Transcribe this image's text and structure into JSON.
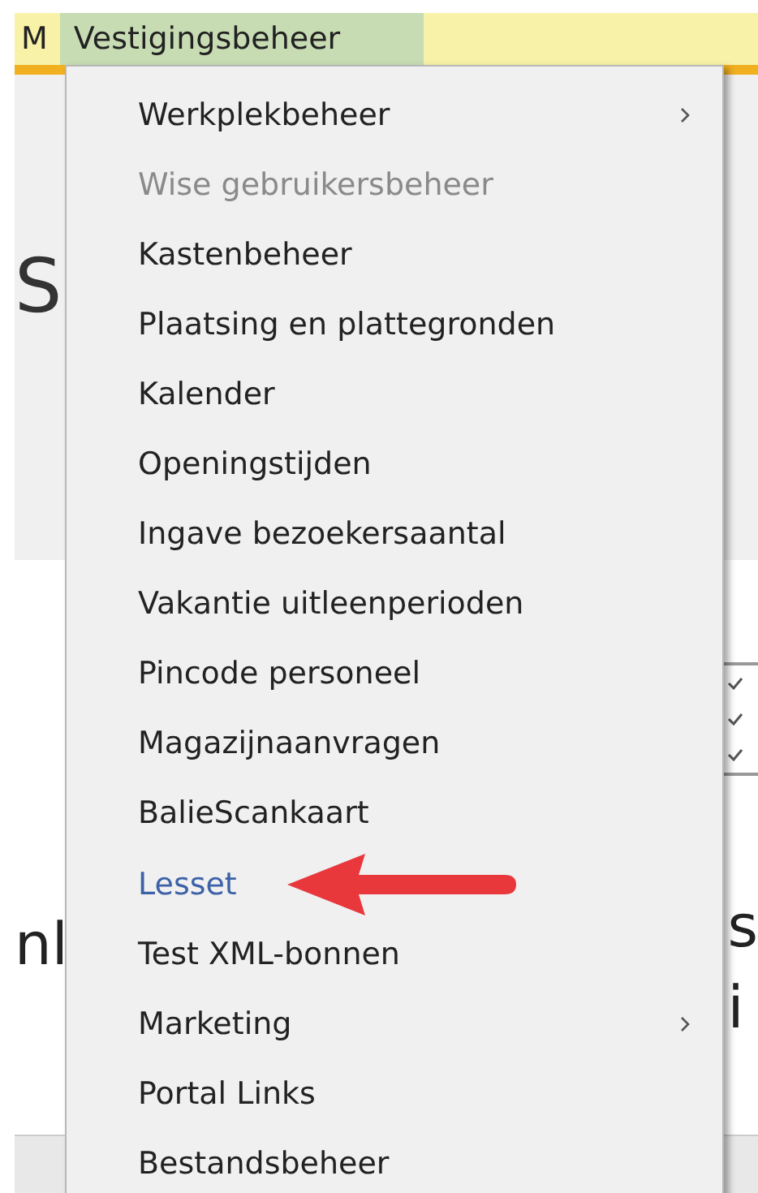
{
  "menubar": {
    "items": [
      {
        "label": "M",
        "selected": false
      },
      {
        "label": "Vestigingsbeheer",
        "selected": true
      }
    ]
  },
  "page": {
    "heading_fragment": "S",
    "left_fragment": "nl",
    "right_fragments": [
      "s",
      "i"
    ]
  },
  "menu": {
    "items": [
      {
        "label": "Werkplekbeheer",
        "kind": "submenu",
        "disabled": false,
        "selected": false
      },
      {
        "label": "Wise gebruikersbeheer",
        "kind": "plain",
        "disabled": true,
        "selected": false
      },
      {
        "label": "Kastenbeheer",
        "kind": "plain",
        "disabled": false,
        "selected": false
      },
      {
        "label": "Plaatsing en plattegronden",
        "kind": "plain",
        "disabled": false,
        "selected": false
      },
      {
        "label": "Kalender",
        "kind": "plain",
        "disabled": false,
        "selected": false
      },
      {
        "label": "Openingstijden",
        "kind": "plain",
        "disabled": false,
        "selected": false
      },
      {
        "label": "Ingave bezoekersaantal",
        "kind": "plain",
        "disabled": false,
        "selected": false
      },
      {
        "label": "Vakantie uitleenperioden",
        "kind": "plain",
        "disabled": false,
        "selected": false
      },
      {
        "label": "Pincode personeel",
        "kind": "plain",
        "disabled": false,
        "selected": false
      },
      {
        "label": "Magazijnaanvragen",
        "kind": "plain",
        "disabled": false,
        "selected": false
      },
      {
        "label": "BalieScankaart",
        "kind": "plain",
        "disabled": false,
        "selected": false
      },
      {
        "label": "Lesset",
        "kind": "plain",
        "disabled": false,
        "selected": true,
        "pointed": true
      },
      {
        "label": "Test XML-bonnen",
        "kind": "plain",
        "disabled": false,
        "selected": false
      },
      {
        "label": "Marketing",
        "kind": "submenu",
        "disabled": false,
        "selected": false
      },
      {
        "label": "Portal Links",
        "kind": "plain",
        "disabled": false,
        "selected": false
      },
      {
        "label": "Bestandsbeheer",
        "kind": "plain",
        "disabled": false,
        "selected": false
      }
    ]
  }
}
